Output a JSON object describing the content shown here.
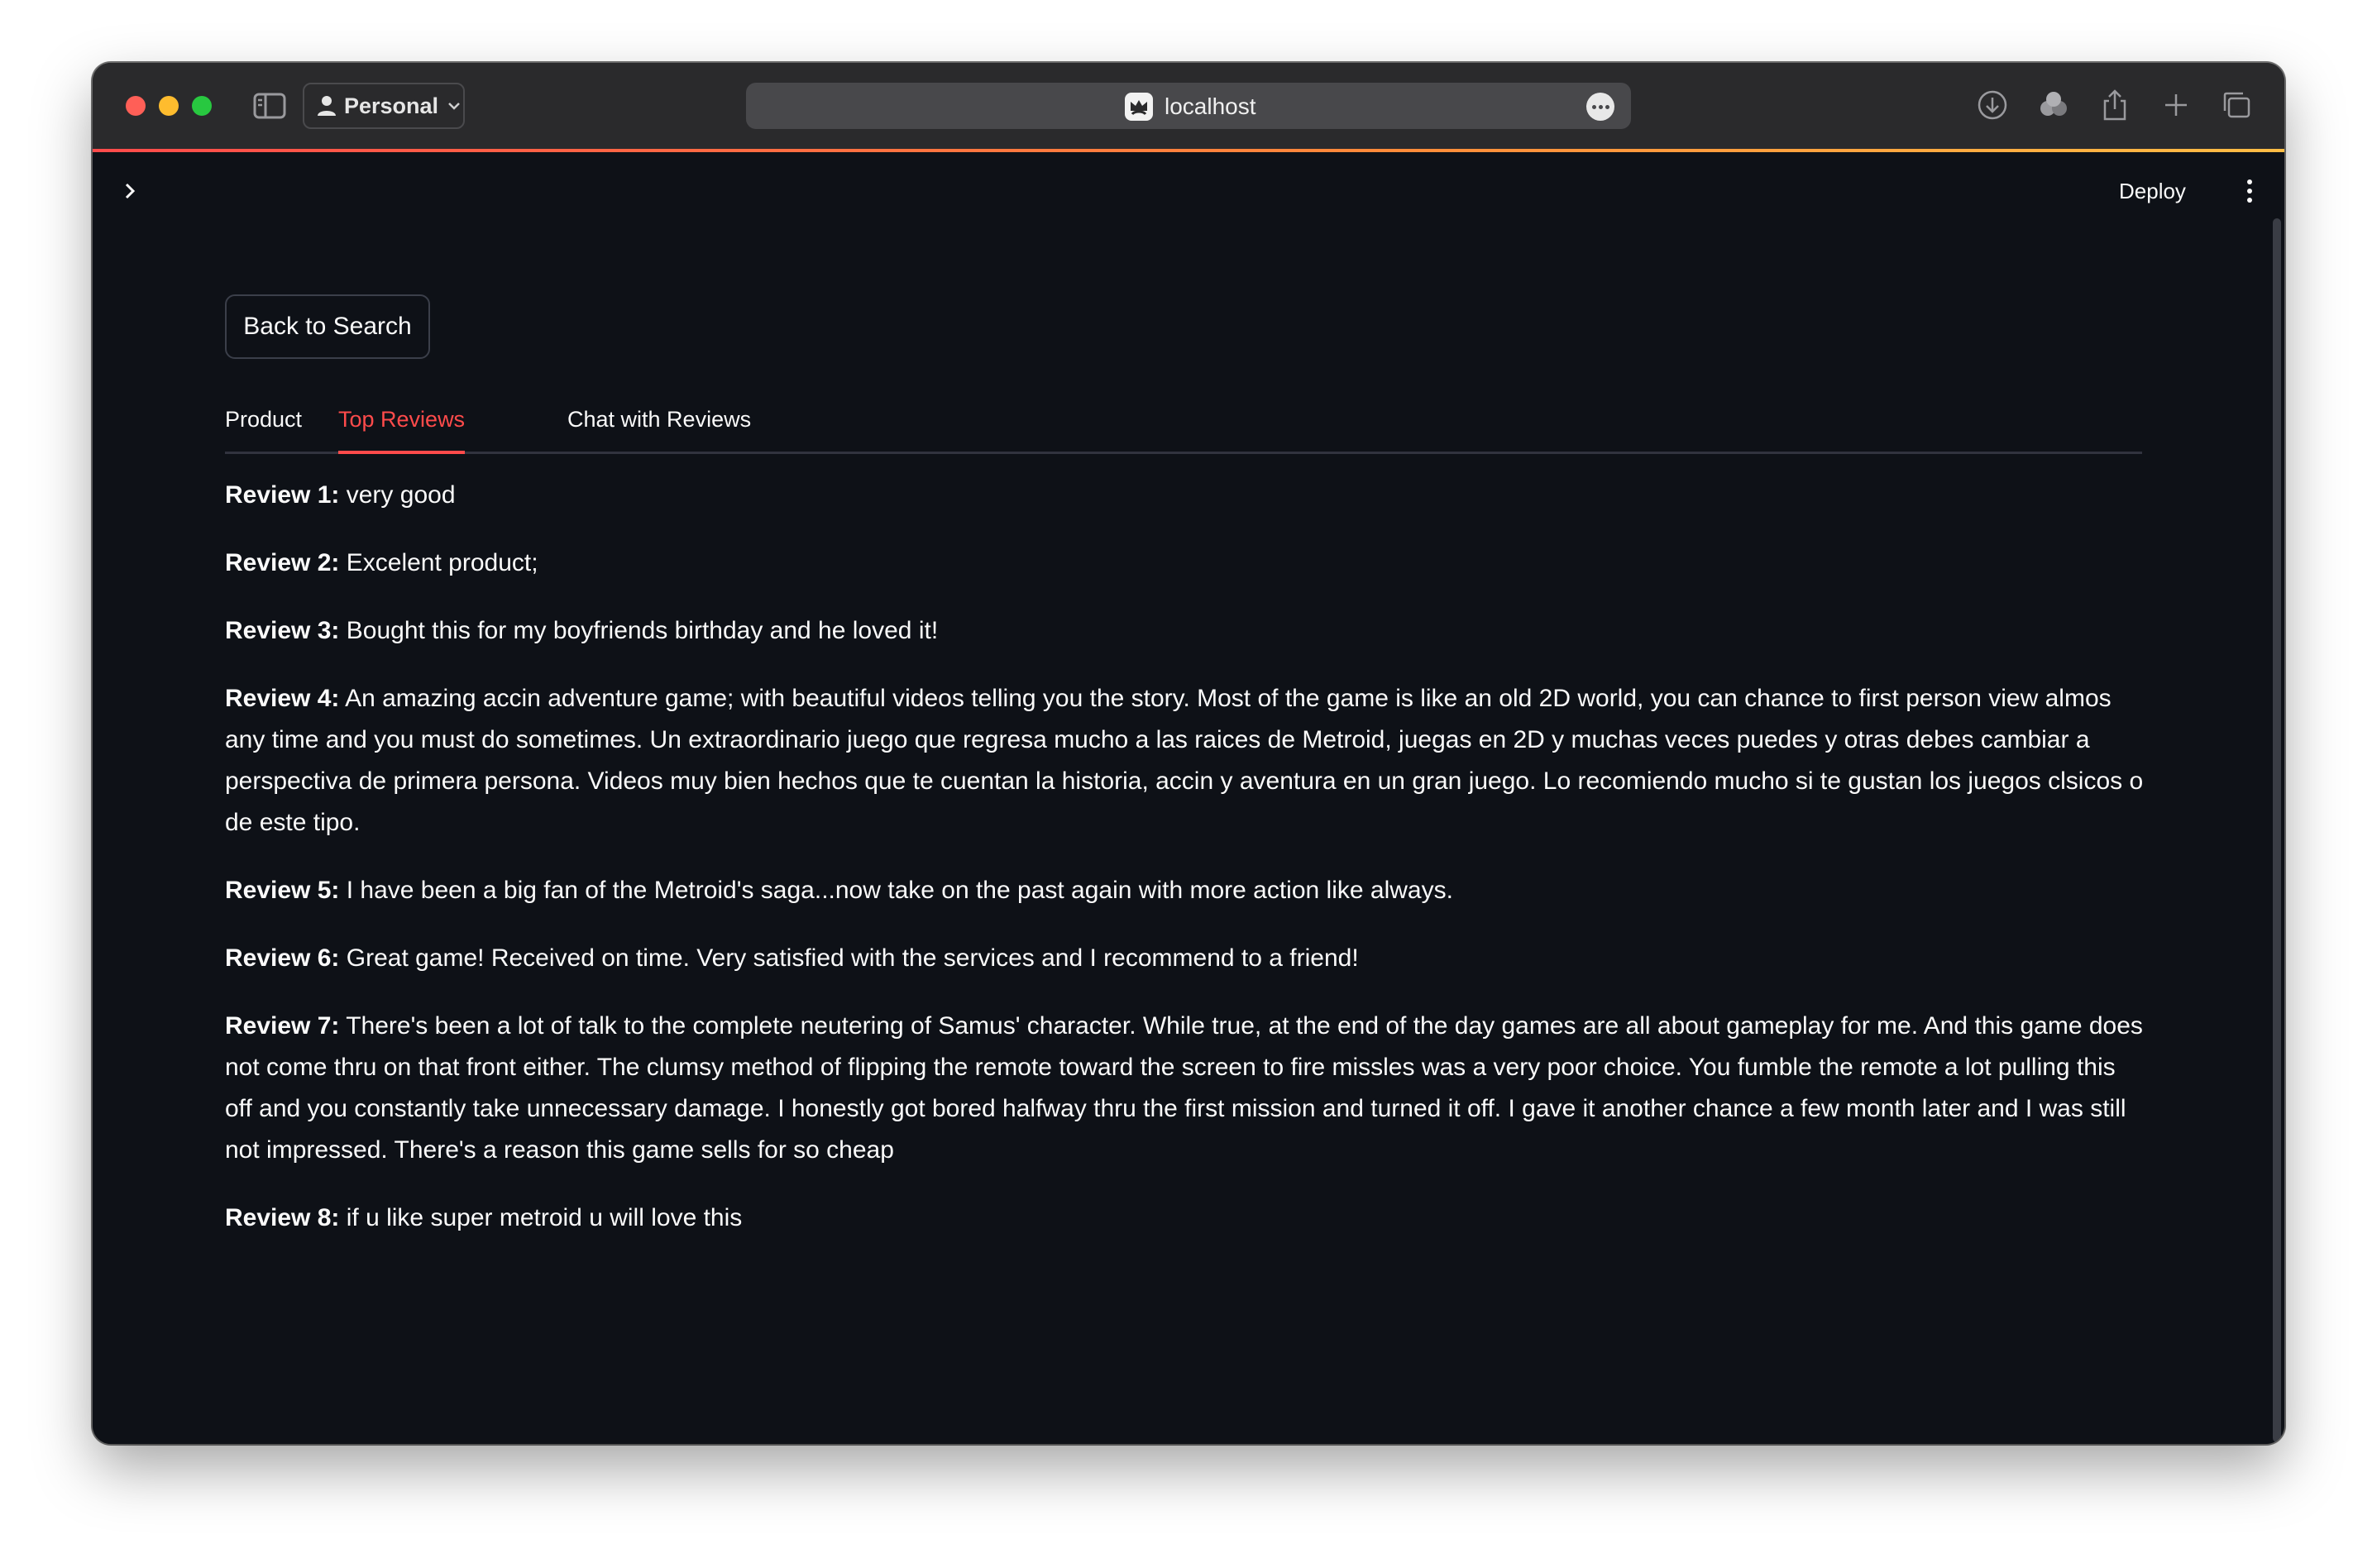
{
  "browser": {
    "profile_label": "Personal",
    "url": "localhost"
  },
  "app": {
    "deploy_label": "Deploy",
    "back_button_label": "Back to Search",
    "tabs": [
      {
        "label": "Product",
        "active": false
      },
      {
        "label": "Top Reviews",
        "active": true
      },
      {
        "label": "Chat with Reviews",
        "active": false
      }
    ],
    "reviews": [
      {
        "label": "Review 1:",
        "text": "very good"
      },
      {
        "label": "Review 2:",
        "text": "Excelent product;"
      },
      {
        "label": "Review 3:",
        "text": "Bought this for my boyfriends birthday and he loved it!"
      },
      {
        "label": "Review 4:",
        "text": "An amazing accin adventure game; with beautiful videos telling you the story. Most of the game is like an old 2D world, you can chance to first person view almos any time and you must do sometimes. Un extraordinario juego que regresa mucho a las raices de Metroid, juegas en 2D y muchas veces puedes y otras debes cambiar a perspectiva de primera persona. Videos muy bien hechos que te cuentan la historia, accin y aventura en un gran juego. Lo recomiendo mucho si te gustan los juegos clsicos o de este tipo."
      },
      {
        "label": "Review 5:",
        "text": "I have been a big fan of the Metroid's saga...now take on the past again with more action like always."
      },
      {
        "label": "Review 6:",
        "text": "Great game! Received on time. Very satisfied with the services and I recommend to a friend!"
      },
      {
        "label": "Review 7:",
        "text": "There's been a lot of talk to the complete neutering of Samus' character. While true, at the end of the day games are all about gameplay for me. And this game does not come thru on that front either. The clumsy method of flipping the remote toward the screen to fire missles was a very poor choice. You fumble the remote a lot pulling this off and you constantly take unnecessary damage. I honestly got bored halfway thru the first mission and turned it off. I gave it another chance a few month later and I was still not impressed. There's a reason this game sells for so cheap"
      },
      {
        "label": "Review 8:",
        "text": "if u like super metroid u will love this"
      }
    ]
  },
  "colors": {
    "background": "#0e1117",
    "accent": "#ff4b4b",
    "text": "#fafafa"
  }
}
